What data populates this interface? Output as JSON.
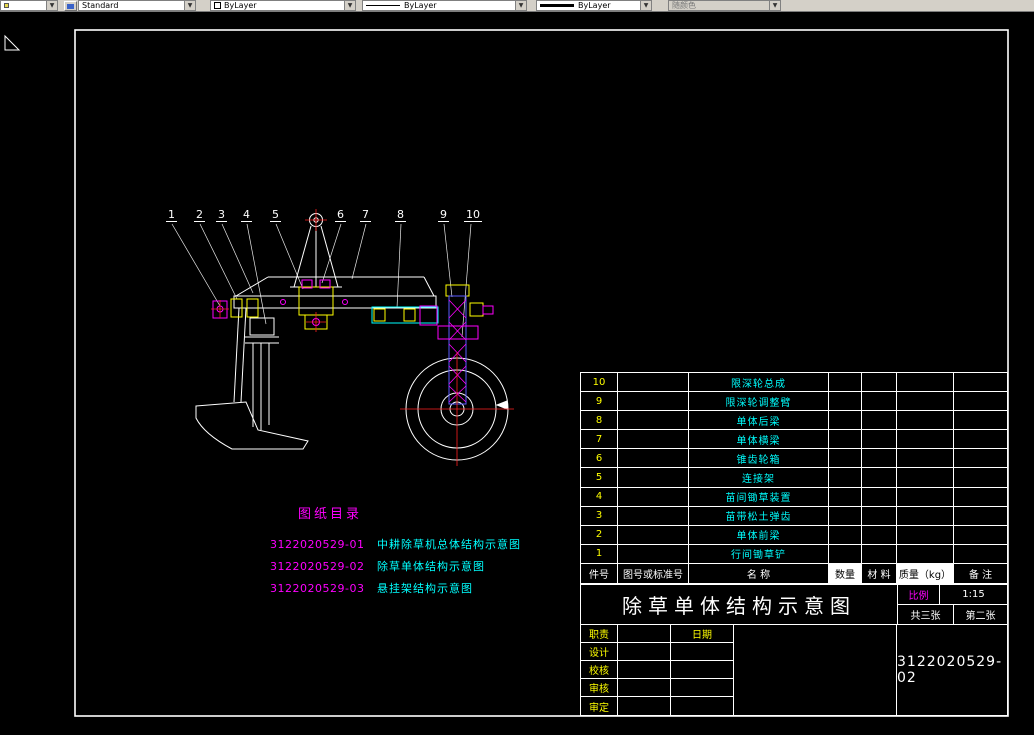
{
  "colors": {
    "canvas_bg": "#000000",
    "toolbar_bg": "#d4d0c8",
    "line_white": "#ffffff",
    "cyan": "#00ffff",
    "magenta": "#ff00ff",
    "yellow": "#ffff00",
    "red": "#ff2020",
    "blue": "#5a5aff"
  },
  "toolbar": {
    "style_value": "Standard",
    "color_value": "ByLayer",
    "linetype_value": "ByLayer",
    "lineweight_value": "ByLayer",
    "plot_style_value": "随颜色",
    "dropdown_arrow": "▼"
  },
  "callouts": {
    "labels": [
      "1",
      "2",
      "3",
      "4",
      "5",
      "6",
      "7",
      "8",
      "9",
      "10"
    ]
  },
  "catalog": {
    "title": "图纸目录",
    "items": [
      {
        "no": "3122020529-01",
        "name": "中耕除草机总体结构示意图"
      },
      {
        "no": "3122020529-02",
        "name": "除草单体结构示意图"
      },
      {
        "no": "3122020529-03",
        "name": "悬挂架结构示意图"
      }
    ]
  },
  "parts_table": {
    "headers": {
      "part_no": "件号",
      "drawing_no": "图号或标准号",
      "name": "名  称",
      "qty": "数量",
      "material": "材 料",
      "weight": "质量（kg）",
      "remarks": "备 注"
    },
    "rows": [
      {
        "no": "10",
        "name": "限深轮总成"
      },
      {
        "no": "9",
        "name": "限深轮调整臂"
      },
      {
        "no": "8",
        "name": "单体后梁"
      },
      {
        "no": "7",
        "name": "单体横梁"
      },
      {
        "no": "6",
        "name": "锥齿轮箱"
      },
      {
        "no": "5",
        "name": "连接架"
      },
      {
        "no": "4",
        "name": "苗间锄草装置"
      },
      {
        "no": "3",
        "name": "苗带松土弹齿"
      },
      {
        "no": "2",
        "name": "单体前梁"
      },
      {
        "no": "1",
        "name": "行间锄草铲"
      }
    ]
  },
  "title_block": {
    "title": "除草单体结构示意图",
    "scale_label": "比例",
    "scale_value": "1:15",
    "sheet_total": "共三张",
    "sheet_index": "第二张",
    "date_label": "日期",
    "drawing_number": "3122020529-02",
    "roles": [
      {
        "label": "职责"
      },
      {
        "label": "设计"
      },
      {
        "label": "校核"
      },
      {
        "label": "审核"
      },
      {
        "label": "审定"
      }
    ]
  }
}
